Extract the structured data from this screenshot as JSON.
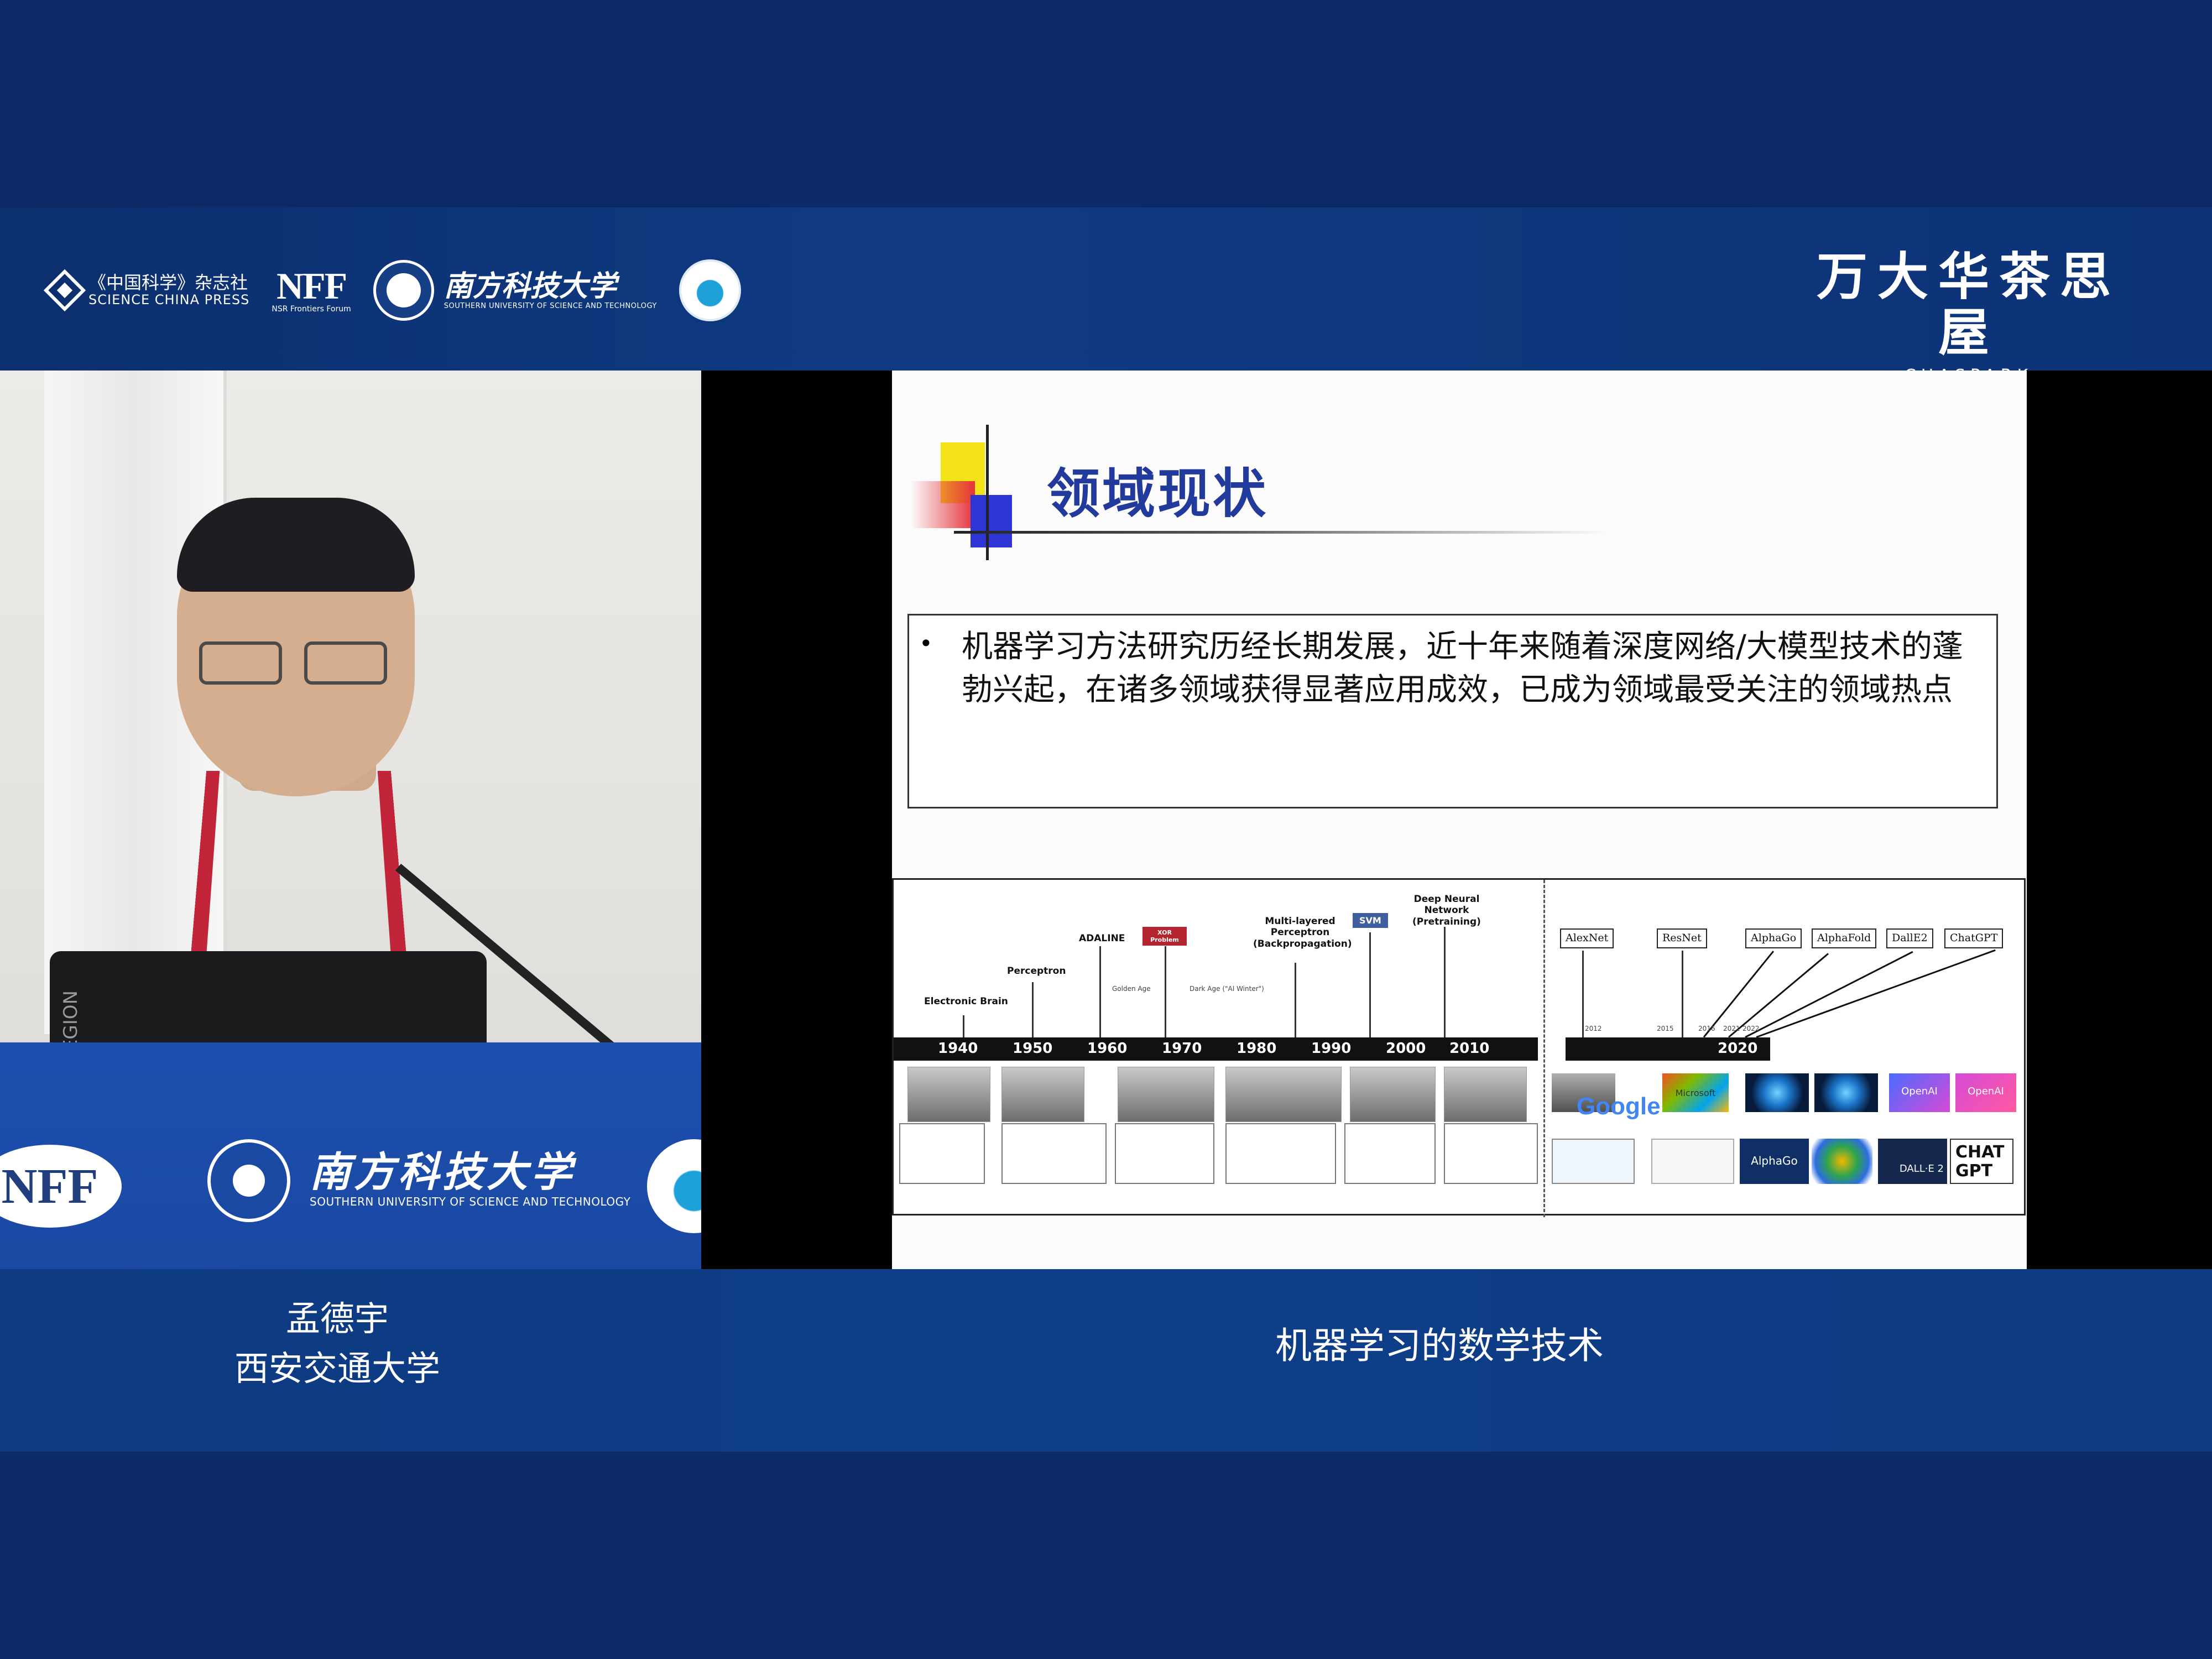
{
  "header": {
    "logos": {
      "science_china_zh": "《中国科学》杂志社",
      "science_china_en": "SCIENCE CHINA PRESS",
      "nff": "NFF",
      "nff_sub": "NSR Frontiers Forum",
      "sustech_zh": "南方科技大学",
      "sustech_en": "SOUTHERN UNIVERSITY OF SCIENCE AND TECHNOLOGY"
    },
    "brand_zh": "万大华茶思屋",
    "brand_en": "CHASPARK"
  },
  "speaker_video": {
    "laptop_label": "LEGION",
    "podium_nff": "NFF",
    "podium_sustech_zh": "南方科技大学",
    "podium_sustech_en": "SOUTHERN UNIVERSITY OF SCIENCE AND TECHNOLOGY"
  },
  "slide": {
    "title": "领域现状",
    "bullet_mark": "•",
    "bullet": "机器学习方法研究历经长期发展，近十年来随着深度网络/大模型技术的蓬勃兴起，在诸多领域获得显著应用成效，已成为领域最受关注的领域热点",
    "timeline": {
      "years": [
        "1940",
        "1950",
        "1960",
        "1970",
        "1980",
        "1990",
        "2000",
        "2010"
      ],
      "events": {
        "electronic_brain": "Electronic Brain",
        "perceptron": "Perceptron",
        "adaline": "ADALINE",
        "xor": "XOR Problem",
        "multilayer": "Multi-layered Perceptron (Backpropagation)",
        "svm": "SVM",
        "dnn": "Deep Neural Network (Pretraining)"
      },
      "golden_age": "Golden Age",
      "dark_age": "Dark Age (\"AI Winter\")",
      "recent_year": "2020",
      "models": [
        "AlexNet",
        "ResNet",
        "AlphaGo",
        "AlphaFold",
        "DallE2",
        "ChatGPT"
      ],
      "model_years": [
        "2012",
        "2015",
        "2016",
        "2021",
        "2022"
      ],
      "logos": {
        "google": "Google",
        "microsoft": "Microsoft",
        "openai": "OpenAI",
        "alphago": "AlphaGo",
        "dalle": "DALL·E 2",
        "chatgpt": "CHAT GPT"
      }
    }
  },
  "caption": {
    "speaker_name": "孟德宇",
    "speaker_affiliation": "西安交通大学",
    "talk_title": "机器学习的数学技术"
  },
  "colors": {
    "background": "#0b2a63",
    "band": "#0f3a82",
    "podium": "#1a49a3",
    "slide_title": "#223a9b",
    "xor_tag": "#b3262f",
    "svm_tag": "#3f5f9f"
  }
}
